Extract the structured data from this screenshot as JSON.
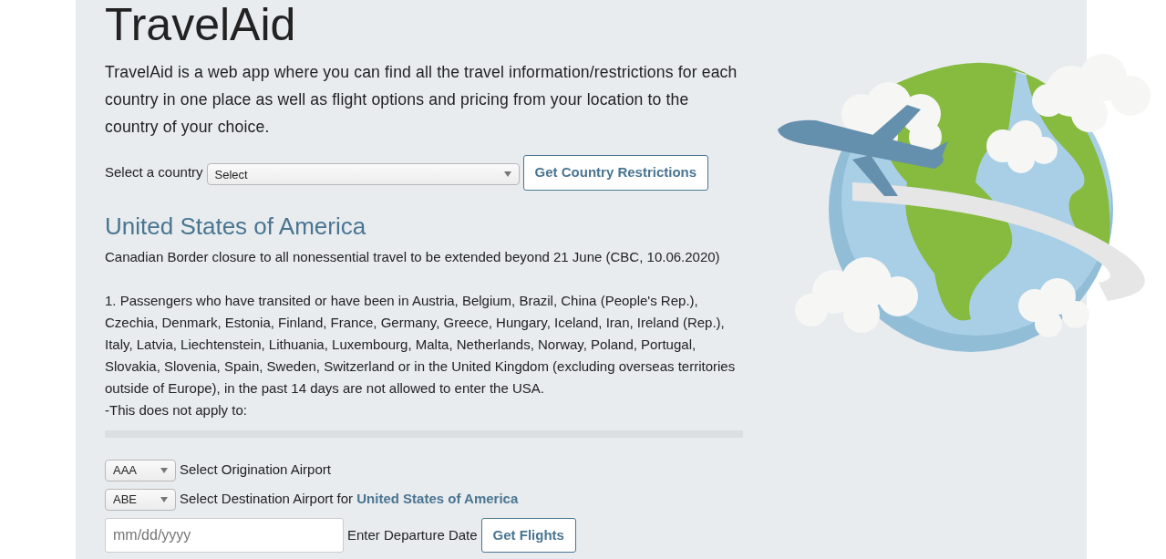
{
  "header": {
    "title": "TravelAid",
    "intro": "TravelAid is a web app where you can find all the travel information/restrictions for each country in one place as well as flight options and pricing from your location to the country of your choice."
  },
  "country_picker": {
    "label": "Select a country",
    "value": "Select",
    "button": "Get Country Restrictions"
  },
  "restrictions": {
    "country": "United States of America",
    "paragraphs": [
      {
        "lines": [
          "Canadian Border closure to all nonessential travel to be extended beyond 21 June (CBC, 10.06.2020)"
        ]
      },
      {
        "lines": [
          "1. Passengers who have transited or have been in Austria, Belgium, Brazil, China (People's Rep.), Czechia, Denmark, Estonia, Finland, France, Germany, Greece, Hungary, Iceland, Iran, Ireland (Rep.), Italy, Latvia, Liechtenstein, Lithuania, Luxembourg, Malta, Netherlands, Norway, Poland, Portugal, Slovakia, Slovenia, Spain, Sweden, Switzerland or in the United Kingdom (excluding overseas territories outside of Europe), in the past 14 days are not allowed to enter the USA.",
          "-This does not apply to:"
        ]
      }
    ]
  },
  "flights": {
    "origin": {
      "value": "AAA",
      "label": "Select Origination Airport"
    },
    "destination": {
      "value": "ABE",
      "label": "Select Destination Airport for **United States of America**"
    },
    "date": {
      "placeholder": "mm/dd/yyyy",
      "label": "Enter Departure Date"
    },
    "button": "Get Flights"
  }
}
